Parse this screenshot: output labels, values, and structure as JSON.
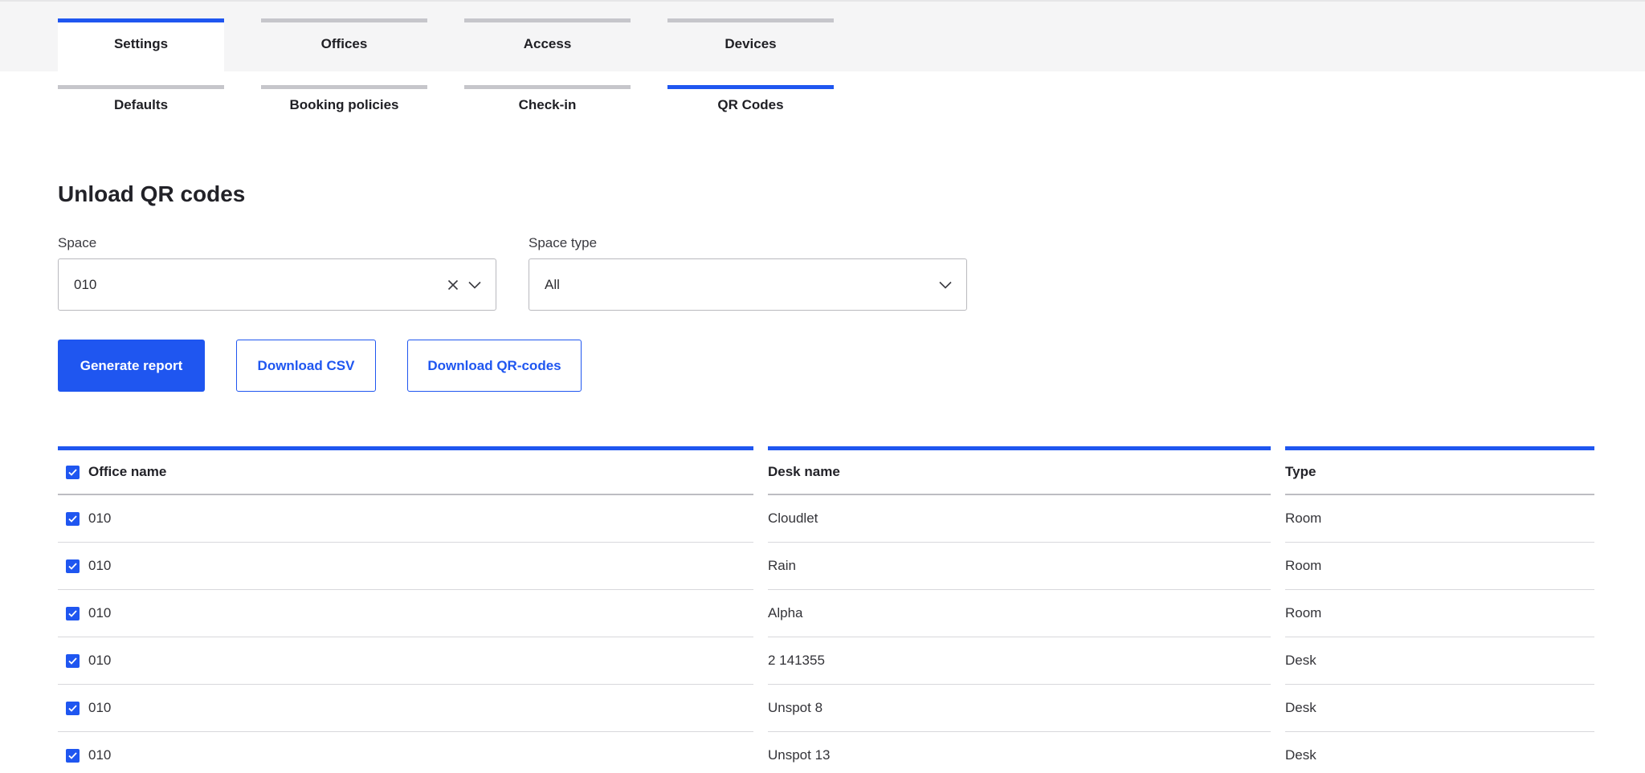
{
  "primary_tabs": [
    {
      "label": "Settings",
      "active": true
    },
    {
      "label": "Offices",
      "active": false
    },
    {
      "label": "Access",
      "active": false
    },
    {
      "label": "Devices",
      "active": false
    }
  ],
  "secondary_tabs": [
    {
      "label": "Defaults",
      "active": false
    },
    {
      "label": "Booking policies",
      "active": false
    },
    {
      "label": "Check-in",
      "active": false
    },
    {
      "label": "QR Codes",
      "active": true
    }
  ],
  "page": {
    "title": "Unload QR codes"
  },
  "filters": {
    "space": {
      "label": "Space",
      "value": "010"
    },
    "space_type": {
      "label": "Space type",
      "value": "All"
    }
  },
  "actions": {
    "generate": "Generate report",
    "download_csv": "Download CSV",
    "download_qr": "Download QR-codes"
  },
  "table": {
    "headers": {
      "office": "Office name",
      "desk": "Desk name",
      "type": "Type"
    },
    "rows": [
      {
        "office": "010",
        "desk": "Cloudlet",
        "type": "Room",
        "checked": true
      },
      {
        "office": "010",
        "desk": "Rain",
        "type": "Room",
        "checked": true
      },
      {
        "office": "010",
        "desk": "Alpha",
        "type": "Room",
        "checked": true
      },
      {
        "office": "010",
        "desk": "2 141355",
        "type": "Desk",
        "checked": true
      },
      {
        "office": "010",
        "desk": "Unspot 8",
        "type": "Desk",
        "checked": true
      },
      {
        "office": "010",
        "desk": "Unspot 13",
        "type": "Desk",
        "checked": true
      }
    ]
  },
  "colors": {
    "accent": "#1f56f0",
    "tab_inactive": "#c6c6cb",
    "band": "#f5f5f6"
  }
}
